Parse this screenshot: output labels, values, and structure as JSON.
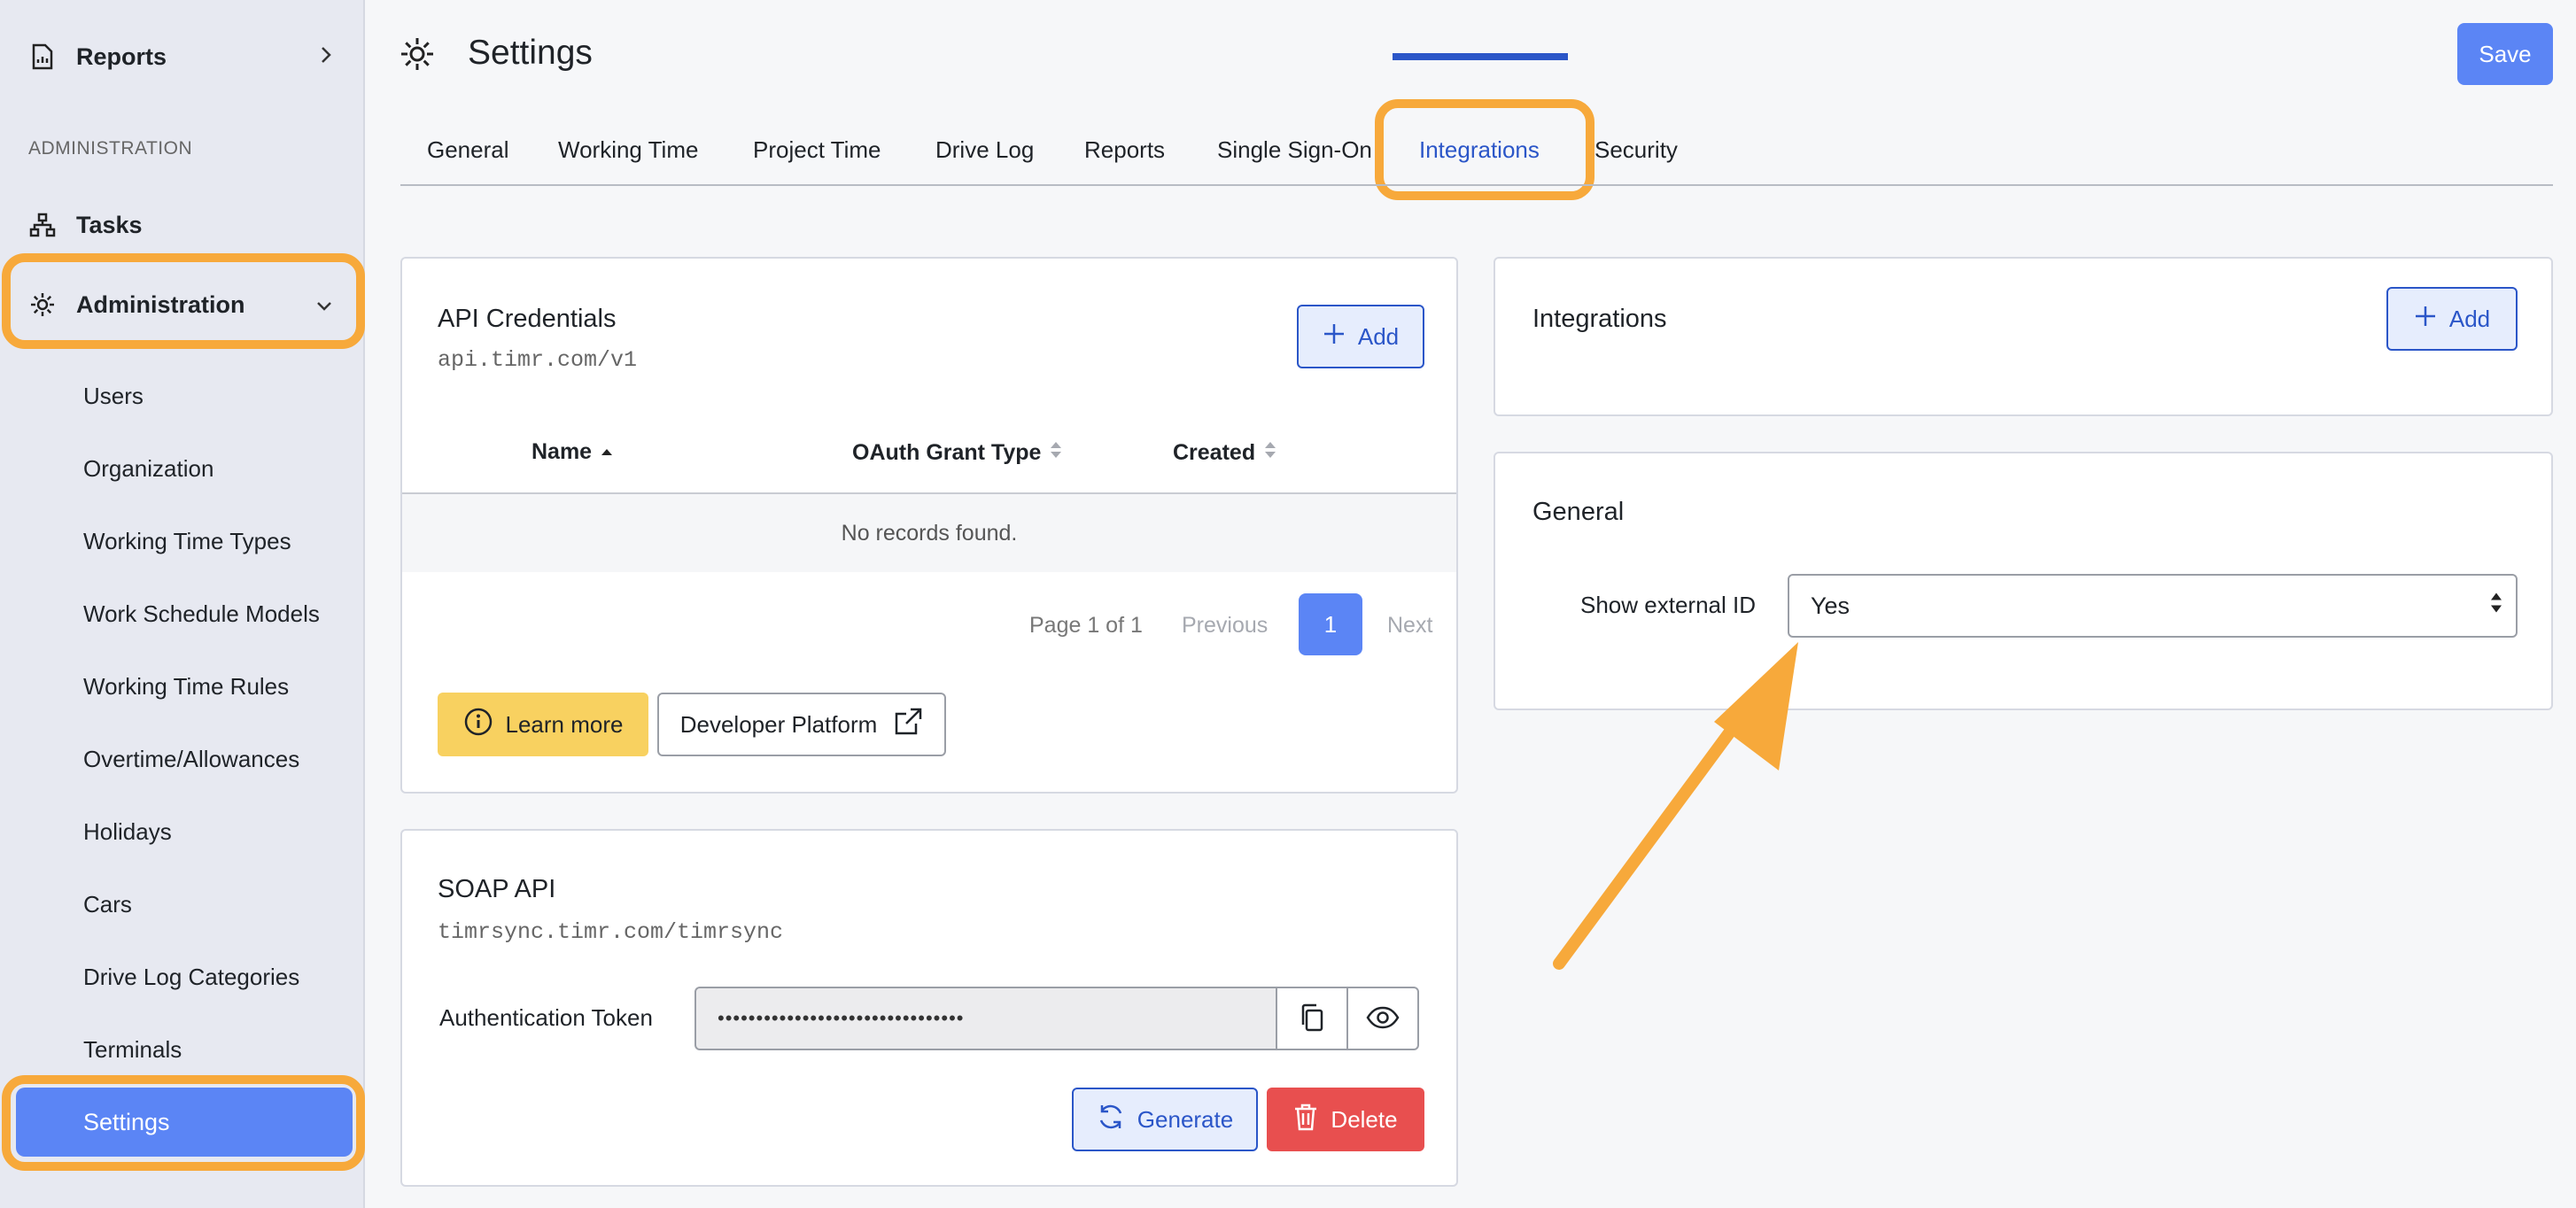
{
  "sidebar": {
    "reports_label": "Reports",
    "section_heading": "ADMINISTRATION",
    "tasks_label": "Tasks",
    "administration_label": "Administration",
    "sub_items": [
      "Users",
      "Organization",
      "Working Time Types",
      "Work Schedule Models",
      "Working Time Rules",
      "Overtime/Allowances",
      "Holidays",
      "Cars",
      "Drive Log Categories",
      "Terminals"
    ],
    "settings_label": "Settings"
  },
  "header": {
    "title": "Settings",
    "save_label": "Save"
  },
  "tabs": [
    "General",
    "Working Time",
    "Project Time",
    "Drive Log",
    "Reports",
    "Single Sign-On",
    "Integrations",
    "Security"
  ],
  "active_tab": "Integrations",
  "api_credentials": {
    "title": "API Credentials",
    "endpoint": "api.timr.com/v1",
    "add_label": "Add",
    "columns": [
      "Name",
      "OAuth Grant Type",
      "Created"
    ],
    "empty_text": "No records found.",
    "pager_info": "Page 1 of 1",
    "previous_label": "Previous",
    "current_page": "1",
    "next_label": "Next",
    "learn_more_label": "Learn more",
    "developer_platform_label": "Developer Platform"
  },
  "soap_api": {
    "title": "SOAP API",
    "endpoint": "timrsync.timr.com/timrsync",
    "token_label": "Authentication Token",
    "token_value": "••••••••••••••••••••••••••••••••",
    "generate_label": "Generate",
    "delete_label": "Delete"
  },
  "integrations": {
    "title": "Integrations",
    "add_label": "Add"
  },
  "general": {
    "title": "General",
    "show_external_id_label": "Show external ID",
    "show_external_id_value": "Yes"
  },
  "colors": {
    "accent": "#5b85f5",
    "highlight": "#f7a93b",
    "tab_active": "#2b56c8",
    "danger": "#e84f4f",
    "warning": "#f8d160"
  }
}
